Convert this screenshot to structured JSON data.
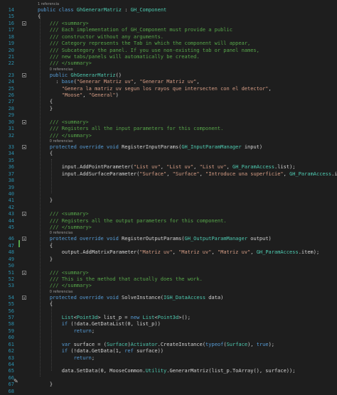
{
  "colors": {
    "background": "#1e1e1e",
    "line_number": "#2b91af",
    "keyword": "#569cd6",
    "type": "#4ec9b0",
    "string": "#d69d85",
    "comment": "#57a64a",
    "plain": "#d4d4d4",
    "codelens": "#999999",
    "change_marker": "#57a64a"
  },
  "icons": {
    "edit": "pencil-icon",
    "fold": "collapse-box-icon"
  },
  "lines": [
    {
      "n": "14",
      "lens": "1 referencia",
      "fold": false,
      "tokens": [
        [
          "kw",
          "public class "
        ],
        [
          "cls",
          "GhGenerarMatriz"
        ],
        [
          "pl",
          " : "
        ],
        [
          "cls",
          "GH_Component"
        ]
      ]
    },
    {
      "n": "15",
      "lens": "",
      "fold": false,
      "tokens": [
        [
          "pl",
          "{"
        ]
      ]
    },
    {
      "n": "16",
      "lens": "",
      "fold": true,
      "tokens": [
        [
          "cmt",
          "    /// <summary>"
        ]
      ]
    },
    {
      "n": "17",
      "lens": "",
      "fold": false,
      "tokens": [
        [
          "cmt",
          "    /// Each implementation of GH_Component must provide a public"
        ]
      ]
    },
    {
      "n": "18",
      "lens": "",
      "fold": false,
      "tokens": [
        [
          "cmt",
          "    /// constructor without any arguments."
        ]
      ]
    },
    {
      "n": "19",
      "lens": "",
      "fold": false,
      "tokens": [
        [
          "cmt",
          "    /// Category represents the Tab in which the component will appear,"
        ]
      ]
    },
    {
      "n": "20",
      "lens": "",
      "fold": false,
      "tokens": [
        [
          "cmt",
          "    /// Subcategory the panel. If you use non-existing tab or panel names,"
        ]
      ]
    },
    {
      "n": "21",
      "lens": "",
      "fold": false,
      "tokens": [
        [
          "cmt",
          "    /// new tabs/panels will automatically be created."
        ]
      ]
    },
    {
      "n": "22",
      "lens": "",
      "fold": false,
      "tokens": [
        [
          "cmt",
          "    /// </summary>"
        ]
      ]
    },
    {
      "n": "23",
      "lens": "0 referencias",
      "fold": true,
      "tokens": [
        [
          "kw",
          "    public "
        ],
        [
          "cls",
          "GhGenerarMatriz"
        ],
        [
          "pl",
          "()"
        ]
      ]
    },
    {
      "n": "24",
      "lens": "",
      "fold": false,
      "tokens": [
        [
          "pl",
          "      : "
        ],
        [
          "kw",
          "base"
        ],
        [
          "pl",
          "("
        ],
        [
          "str",
          "\"Generar Matriz uv\""
        ],
        [
          "pl",
          ", "
        ],
        [
          "str",
          "\"Generar Matriz uv\""
        ],
        [
          "pl",
          ","
        ]
      ]
    },
    {
      "n": "25",
      "lens": "",
      "fold": false,
      "tokens": [
        [
          "str",
          "        \"Genera la matriz uv segun los rayos que intersecten con el detector\""
        ],
        [
          "pl",
          ","
        ]
      ]
    },
    {
      "n": "26",
      "lens": "",
      "fold": false,
      "tokens": [
        [
          "str",
          "        \"Moose\""
        ],
        [
          "pl",
          ", "
        ],
        [
          "str",
          "\"General\""
        ],
        [
          "pl",
          ")"
        ]
      ]
    },
    {
      "n": "27",
      "lens": "",
      "fold": false,
      "tokens": [
        [
          "pl",
          "    {"
        ]
      ]
    },
    {
      "n": "28",
      "lens": "",
      "fold": false,
      "tokens": [
        [
          "pl",
          "    }"
        ]
      ]
    },
    {
      "n": "29",
      "lens": "",
      "fold": false,
      "tokens": [
        [
          "pl",
          ""
        ]
      ]
    },
    {
      "n": "30",
      "lens": "",
      "fold": true,
      "tokens": [
        [
          "cmt",
          "    /// <summary>"
        ]
      ]
    },
    {
      "n": "31",
      "lens": "",
      "fold": false,
      "tokens": [
        [
          "cmt",
          "    /// Registers all the input parameters for this component."
        ]
      ]
    },
    {
      "n": "32",
      "lens": "",
      "fold": false,
      "tokens": [
        [
          "cmt",
          "    /// </summary>"
        ]
      ]
    },
    {
      "n": "33",
      "lens": "0 referencias",
      "fold": true,
      "tokens": [
        [
          "kw",
          "    protected override void "
        ],
        [
          "pl",
          "RegisterInputParams("
        ],
        [
          "cls",
          "GH_InputParamManager"
        ],
        [
          "pl",
          " input)"
        ]
      ]
    },
    {
      "n": "34",
      "lens": "",
      "fold": false,
      "tokens": [
        [
          "pl",
          "    {"
        ]
      ]
    },
    {
      "n": "35",
      "lens": "",
      "fold": false,
      "tokens": [
        [
          "pl",
          ""
        ]
      ]
    },
    {
      "n": "36",
      "lens": "",
      "fold": false,
      "tokens": [
        [
          "pl",
          "        input.AddPointParameter("
        ],
        [
          "str",
          "\"List uv\""
        ],
        [
          "pl",
          ", "
        ],
        [
          "str",
          "\"List uv\""
        ],
        [
          "pl",
          ", "
        ],
        [
          "str",
          "\"List uv\""
        ],
        [
          "pl",
          ", "
        ],
        [
          "cls",
          "GH_ParamAccess"
        ],
        [
          "pl",
          ".list);"
        ]
      ]
    },
    {
      "n": "37",
      "lens": "",
      "fold": false,
      "tokens": [
        [
          "pl",
          "        input.AddSurfaceParameter("
        ],
        [
          "str",
          "\"Surface\""
        ],
        [
          "pl",
          ", "
        ],
        [
          "str",
          "\"Surface\""
        ],
        [
          "pl",
          ", "
        ],
        [
          "str",
          "\"Introduce una superficie\""
        ],
        [
          "pl",
          ", "
        ],
        [
          "cls",
          "GH_ParamAccess"
        ],
        [
          "pl",
          ".item);"
        ]
      ]
    },
    {
      "n": "38",
      "lens": "",
      "fold": false,
      "tokens": [
        [
          "pl",
          ""
        ]
      ]
    },
    {
      "n": "39",
      "lens": "",
      "fold": false,
      "tokens": [
        [
          "pl",
          ""
        ]
      ]
    },
    {
      "n": "40",
      "lens": "",
      "fold": false,
      "tokens": [
        [
          "pl",
          ""
        ]
      ]
    },
    {
      "n": "41",
      "lens": "",
      "fold": false,
      "tokens": [
        [
          "pl",
          "    }"
        ]
      ]
    },
    {
      "n": "42",
      "lens": "",
      "fold": false,
      "tokens": [
        [
          "pl",
          ""
        ]
      ]
    },
    {
      "n": "43",
      "lens": "",
      "fold": true,
      "tokens": [
        [
          "cmt",
          "    /// <summary>"
        ]
      ]
    },
    {
      "n": "44",
      "lens": "",
      "fold": false,
      "tokens": [
        [
          "cmt",
          "    /// Registers all the output parameters for this component."
        ]
      ]
    },
    {
      "n": "45",
      "lens": "",
      "fold": false,
      "tokens": [
        [
          "cmt",
          "    /// </summary>"
        ]
      ]
    },
    {
      "n": "46",
      "lens": "0 referencias",
      "fold": true,
      "tokens": [
        [
          "kw",
          "    protected override void "
        ],
        [
          "pl",
          "RegisterOutputParams("
        ],
        [
          "cls",
          "GH_OutputParamManager"
        ],
        [
          "pl",
          " output)"
        ]
      ]
    },
    {
      "n": "47",
      "lens": "",
      "fold": false,
      "tokens": [
        [
          "pl",
          "    {"
        ]
      ]
    },
    {
      "n": "48",
      "lens": "",
      "fold": false,
      "tokens": [
        [
          "pl",
          "        output.AddMatrixParameter("
        ],
        [
          "str",
          "\"Matriz uv\""
        ],
        [
          "pl",
          ", "
        ],
        [
          "str",
          "\"Matriz uv\""
        ],
        [
          "pl",
          ", "
        ],
        [
          "str",
          "\"Matriz uv\""
        ],
        [
          "pl",
          ", "
        ],
        [
          "cls",
          "GH_ParamAccess"
        ],
        [
          "pl",
          ".item);"
        ]
      ]
    },
    {
      "n": "49",
      "lens": "",
      "fold": false,
      "tokens": [
        [
          "pl",
          "    }"
        ]
      ]
    },
    {
      "n": "50",
      "lens": "",
      "fold": false,
      "tokens": [
        [
          "pl",
          ""
        ]
      ]
    },
    {
      "n": "51",
      "lens": "",
      "fold": true,
      "tokens": [
        [
          "cmt",
          "    /// <summary>"
        ]
      ]
    },
    {
      "n": "52",
      "lens": "",
      "fold": false,
      "tokens": [
        [
          "cmt",
          "    /// This is the method that actually does the work."
        ]
      ]
    },
    {
      "n": "53",
      "lens": "",
      "fold": false,
      "tokens": [
        [
          "cmt",
          "    /// </summary>"
        ]
      ]
    },
    {
      "n": "54",
      "lens": "0 referencias",
      "fold": true,
      "tokens": [
        [
          "kw",
          "    protected override void "
        ],
        [
          "pl",
          "SolveInstance("
        ],
        [
          "cls",
          "IGH_DataAccess"
        ],
        [
          "pl",
          " data)"
        ]
      ]
    },
    {
      "n": "55",
      "lens": "",
      "fold": false,
      "tokens": [
        [
          "pl",
          "    {"
        ]
      ]
    },
    {
      "n": "56",
      "lens": "",
      "fold": false,
      "tokens": [
        [
          "pl",
          ""
        ]
      ]
    },
    {
      "n": "57",
      "lens": "",
      "fold": false,
      "tokens": [
        [
          "cls",
          "        List"
        ],
        [
          "pl",
          "<"
        ],
        [
          "cls",
          "Point3d"
        ],
        [
          "pl",
          "> list_p = "
        ],
        [
          "kw",
          "new "
        ],
        [
          "cls",
          "List"
        ],
        [
          "pl",
          "<"
        ],
        [
          "cls",
          "Point3d"
        ],
        [
          "pl",
          ">();"
        ]
      ]
    },
    {
      "n": "58",
      "lens": "",
      "fold": false,
      "tokens": [
        [
          "kw",
          "        if "
        ],
        [
          "pl",
          "(!data.GetDataList(0, list_p))"
        ]
      ]
    },
    {
      "n": "59",
      "lens": "",
      "fold": false,
      "tokens": [
        [
          "kw",
          "            return"
        ],
        [
          "pl",
          ";"
        ]
      ]
    },
    {
      "n": "60",
      "lens": "",
      "fold": false,
      "tokens": [
        [
          "pl",
          ""
        ]
      ]
    },
    {
      "n": "61",
      "lens": "",
      "fold": false,
      "tokens": [
        [
          "kw",
          "        var "
        ],
        [
          "pl",
          "surface = ("
        ],
        [
          "cls",
          "Surface"
        ],
        [
          "pl",
          ")"
        ],
        [
          "cls",
          "Activator"
        ],
        [
          "pl",
          ".CreateInstance("
        ],
        [
          "kw",
          "typeof"
        ],
        [
          "pl",
          "("
        ],
        [
          "cls",
          "Surface"
        ],
        [
          "pl",
          "), "
        ],
        [
          "kw",
          "true"
        ],
        [
          "pl",
          ");"
        ]
      ]
    },
    {
      "n": "62",
      "lens": "",
      "fold": false,
      "tokens": [
        [
          "kw",
          "        if "
        ],
        [
          "pl",
          "(!data.GetData(1, "
        ],
        [
          "kw",
          "ref "
        ],
        [
          "pl",
          "surface))"
        ]
      ]
    },
    {
      "n": "63",
      "lens": "",
      "fold": false,
      "tokens": [
        [
          "kw",
          "            return"
        ],
        [
          "pl",
          ";"
        ]
      ]
    },
    {
      "n": "64",
      "lens": "",
      "fold": false,
      "tokens": [
        [
          "pl",
          ""
        ]
      ]
    },
    {
      "n": "65",
      "lens": "",
      "fold": false,
      "tokens": [
        [
          "pl",
          "        data.SetData(0, MooseCommon."
        ],
        [
          "cls",
          "Utility"
        ],
        [
          "pl",
          ".GenerarMatriz(list_p.ToArray(), surface));"
        ]
      ]
    },
    {
      "n": "66",
      "lens": "",
      "fold": false,
      "tokens": [
        [
          "pl",
          ""
        ]
      ]
    },
    {
      "n": "67",
      "lens": "",
      "fold": false,
      "tokens": [
        [
          "pl",
          "    }"
        ]
      ]
    },
    {
      "n": "68",
      "lens": "",
      "fold": false,
      "tokens": [
        [
          "pl",
          ""
        ]
      ]
    }
  ]
}
